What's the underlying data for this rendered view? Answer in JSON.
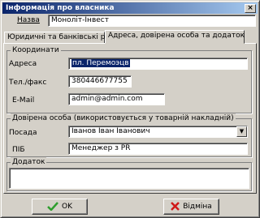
{
  "window": {
    "title": "Інформація про власника",
    "close_glyph": "×"
  },
  "header": {
    "name_label": "Назва",
    "name_value": "Моноліт-Інвест"
  },
  "tabs": [
    {
      "label": "Юридичні та банківські реквізити",
      "active": false
    },
    {
      "label": "Адреса, довірена особа та додаток",
      "active": true
    }
  ],
  "coordinates": {
    "title": "Координати",
    "address_label": "Адреса",
    "address_value": "пл. Перемоэцв",
    "phone_label": "Тел./факс",
    "phone_value": "380446677755",
    "email_label": "E-Mail",
    "email_value": "admin@admin.com"
  },
  "trusted_person": {
    "title": "Довірена особа (використовується у товарній накладній)",
    "position_label": "Посада",
    "position_value": "Іванов Іван Іванович",
    "name_label": "ПІБ",
    "name_value": "Менеджер з PR"
  },
  "appendix": {
    "title": "Додаток",
    "value": ""
  },
  "buttons": {
    "ok_label": "OK",
    "cancel_label": "Відміна"
  },
  "colors": {
    "ok_icon": "#2e9e2e",
    "cancel_icon": "#d01818",
    "selection": "#0a246a"
  }
}
